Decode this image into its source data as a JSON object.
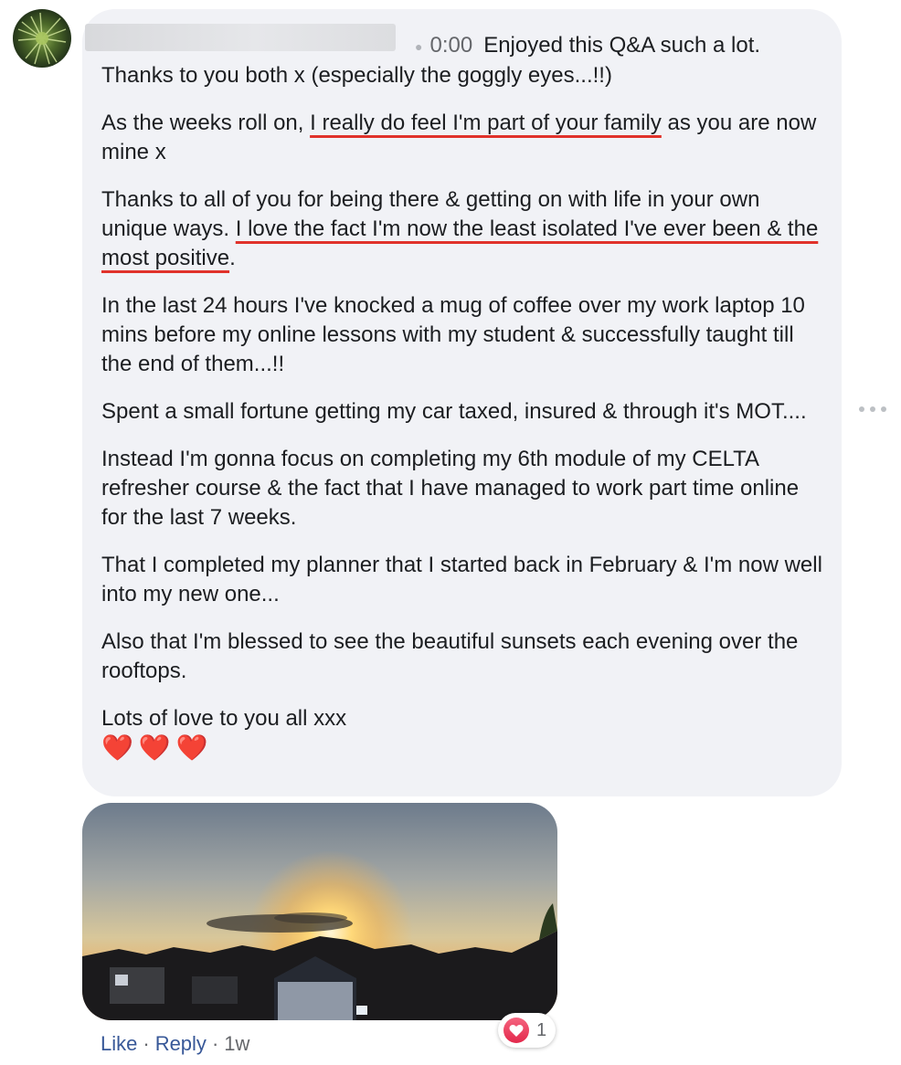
{
  "comment": {
    "author_redacted": true,
    "timestamp_link": "0:00",
    "first_line_rest": "Enjoyed this Q&A such a lot.",
    "paragraphs": {
      "p1_line2": "Thanks to you both x (especially the goggly eyes...!!)",
      "p2_pre": "As the weeks roll on, ",
      "p2_highlight": "I really do feel I'm part of your family",
      "p2_post": " as you are now mine x",
      "p3_pre": "Thanks to all of you for being there & getting on with life in your own unique ways. ",
      "p3_highlight": "I love the fact I'm now the least isolated I've ever been & the most positive",
      "p3_post": ".",
      "p4": "In the last 24 hours I've knocked a mug of coffee over my work laptop 10 mins before my online lessons with my student & successfully taught till the end of them...!!",
      "p5": "Spent a small fortune getting my car taxed, insured & through it's MOT....",
      "p6": "Instead I'm gonna focus on completing my 6th module of my CELTA refresher course & the fact that I have managed to work part time online for the last 7 weeks.",
      "p7": "That I completed my planner that I started back in February & I'm now well into my new one...",
      "p8": "Also that I'm blessed to see the beautiful sunsets each evening over the rooftops.",
      "p9": "Lots of love to you all xxx",
      "hearts": "❤️❤️❤️"
    },
    "highlight_color": "#e0322b"
  },
  "reactions": {
    "icon": "love-icon",
    "count": "1"
  },
  "actions": {
    "like_label": "Like",
    "separator": "·",
    "reply_label": "Reply",
    "age": "1w"
  },
  "icons": {
    "more_options": "more-horizontal-icon"
  }
}
